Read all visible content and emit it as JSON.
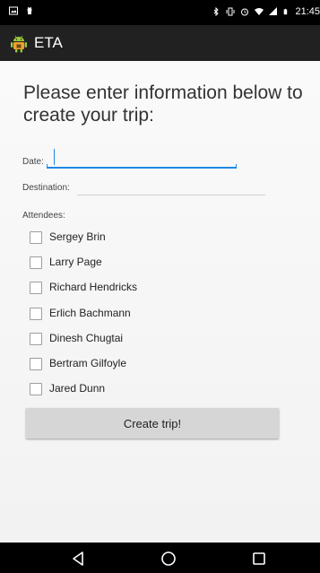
{
  "status_bar": {
    "time": "21:45",
    "icons": [
      "image-icon",
      "android-debug-icon",
      "bluetooth-icon",
      "vibrate-icon",
      "alarm-icon",
      "wifi-icon",
      "signal-icon",
      "battery-icon"
    ]
  },
  "app_bar": {
    "title": "ETA",
    "logo": "android-logo-icon"
  },
  "form": {
    "heading": "Please enter information below to create your trip:",
    "date_label": "Date:",
    "date_value": "",
    "destination_label": "Destination:",
    "destination_value": "",
    "attendees_label": "Attendees:",
    "attendees": [
      {
        "name": "Sergey Brin",
        "checked": false
      },
      {
        "name": "Larry Page",
        "checked": false
      },
      {
        "name": "Richard Hendricks",
        "checked": false
      },
      {
        "name": "Erlich Bachmann",
        "checked": false
      },
      {
        "name": "Dinesh Chugtai",
        "checked": false
      },
      {
        "name": "Bertram Gilfoyle",
        "checked": false
      },
      {
        "name": "Jared Dunn",
        "checked": false
      }
    ],
    "submit_label": "Create trip!"
  },
  "nav_bar": {
    "buttons": [
      "back-icon",
      "home-icon",
      "recents-icon"
    ]
  },
  "colors": {
    "accent": "#1e88e5",
    "app_bar": "#212121",
    "status_bar": "#000000",
    "button_bg": "#d6d6d6"
  }
}
